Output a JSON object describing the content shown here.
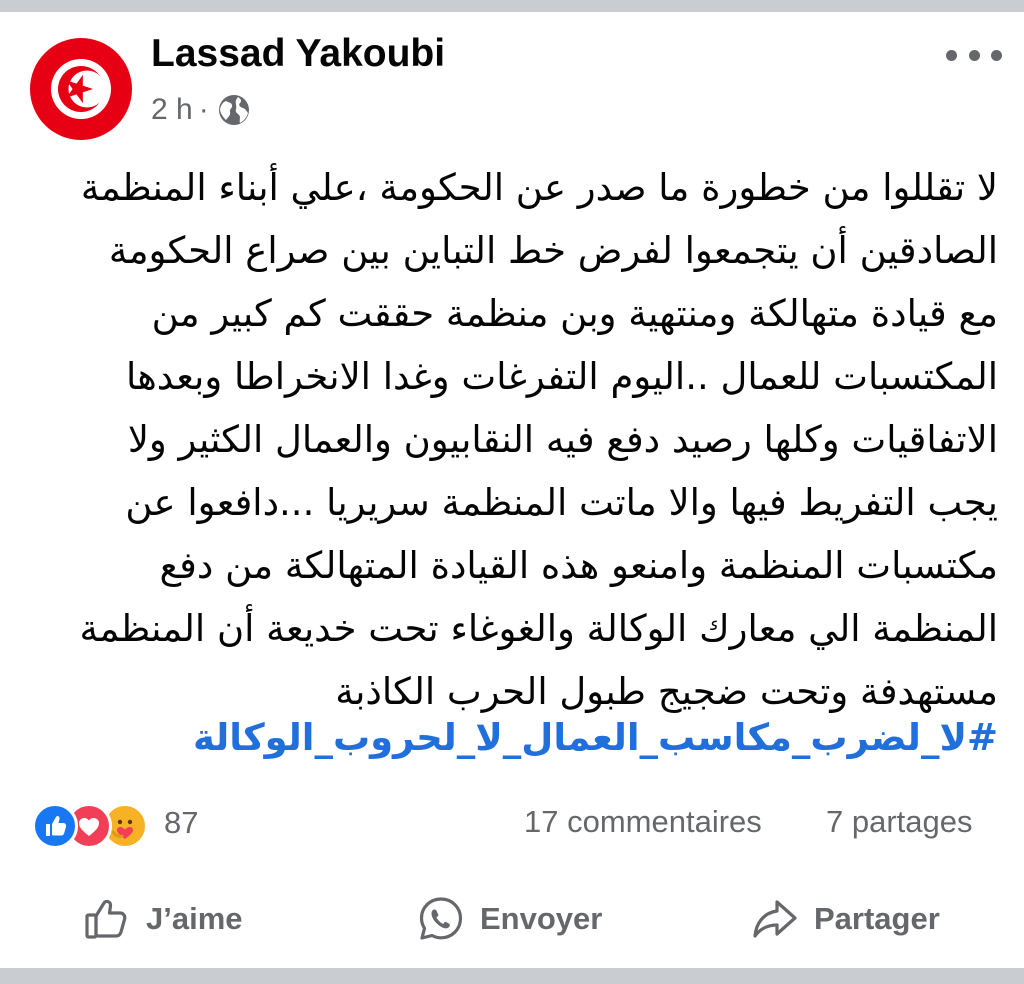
{
  "colors": {
    "accent": "#216fdb",
    "secondary_text": "#65676b",
    "divider": "#c9ccd1",
    "flag_red": "#e70013"
  },
  "post": {
    "author": "Lassad Yakoubi",
    "avatar": "tunisia-flag",
    "time": "2 h",
    "separator": "·",
    "audience_icon": "globe-icon",
    "more_icon": "more-dots-icon",
    "lines": [
      "لا تقللوا من خطورة ما صدر عن الحكومة ،علي أبناء المنظمة",
      "الصادقين أن يتجمعوا لفرض خط التباين بين  صراع الحكومة",
      "مع قيادة متهالكة ومنتهية  وبن منظمة حققت  كم كبير من",
      "المكتسبات  للعمال ..اليوم التفرغات وغدا الانخراطا   وبعدها",
      "الاتفاقيات وكلها رصيد دفع فيه النقابيون والعمال الكثير  ولا",
      "يجب التفريط فيها والا ماتت المنظمة سريريا ...دافعوا عن",
      "مكتسبات  المنظمة وامنعو  هذه القيادة المتهالكة  من دفع",
      "المنظمة الي معارك الوكالة والغوغاء تحت خديعة  أن المنظمة",
      "مستهدفة وتحت ضجيج طبول الحرب الكاذبة"
    ],
    "hashtag": "#لا_لضرب_مكاسب_العمال_لا_لحروب_الوكالة"
  },
  "stats": {
    "reaction_icons": [
      "like-icon",
      "love-icon",
      "care-icon"
    ],
    "reactions_count": "87",
    "comments": "17 commentaires",
    "shares": "7 partages"
  },
  "actions": {
    "like": "J’aime",
    "send": "Envoyer",
    "share": "Partager"
  }
}
